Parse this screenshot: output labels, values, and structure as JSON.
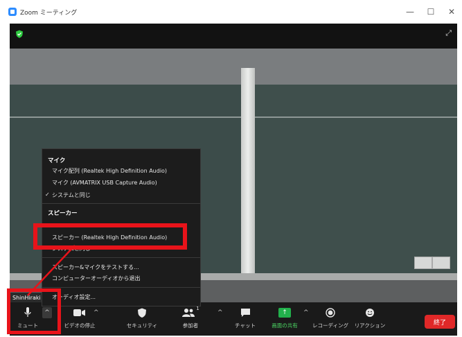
{
  "window": {
    "title": "Zoom ミーティング",
    "minimize": "—",
    "maximize": "☐",
    "close": "✕"
  },
  "meeting": {
    "participant_name": "ShinHiraki",
    "expand_icon": "⤢"
  },
  "audio_menu": {
    "mic_heading": "マイク",
    "mic_options": [
      {
        "label": "マイク配列 (Realtek High Definition Audio)",
        "checked": false
      },
      {
        "label": "マイク (AVMATRIX USB Capture Audio)",
        "checked": false
      },
      {
        "label": "システムと同じ",
        "checked": true
      }
    ],
    "speaker_heading": "スピーカー",
    "speaker_options": [
      {
        "label": "スピーカー (Realtek High Definition Audio)",
        "checked": false
      },
      {
        "label": "システムと同じ",
        "checked": true
      }
    ],
    "actions": [
      {
        "label": "スピーカー&マイクをテストする..."
      },
      {
        "label": "コンピューターオーディオから退出"
      }
    ],
    "settings": "オーディオ設定..."
  },
  "toolbar": {
    "mute": "ミュート",
    "video": "ビデオの停止",
    "security": "セキュリティ",
    "participants": "参加者",
    "participant_count": "1",
    "chat": "チャット",
    "share": "画面の共有",
    "record": "レコーディング",
    "reactions": "リアクション",
    "end": "終了"
  },
  "colors": {
    "accent_red": "#e8131a",
    "share_green": "#22b14c",
    "end_red": "#e02828"
  }
}
